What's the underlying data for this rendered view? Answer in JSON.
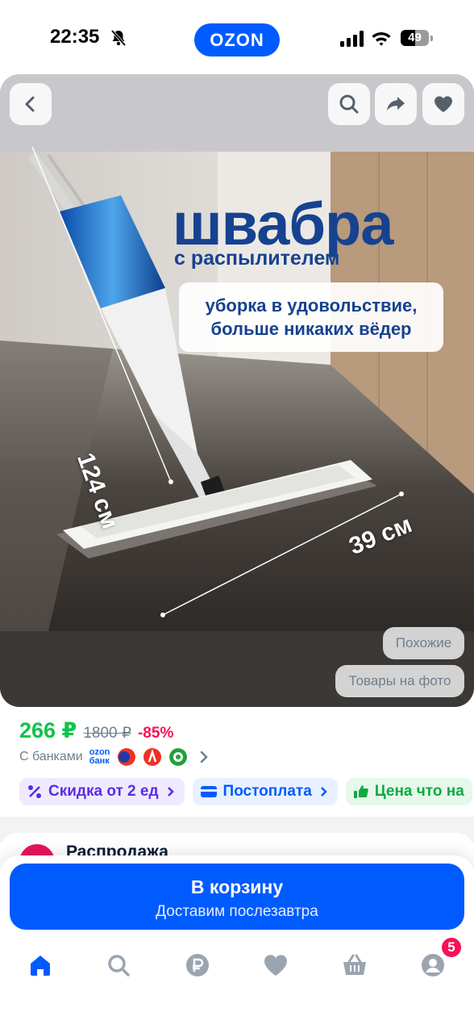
{
  "status_bar": {
    "time": "22:35",
    "app_badge": "OZON",
    "battery": "49"
  },
  "image_toolbar": {
    "back_icon": "chevron-left-icon",
    "search_icon": "search-icon",
    "share_icon": "share-icon",
    "favorite_icon": "heart-icon"
  },
  "product_image": {
    "title": "швабра",
    "subtitle": "с распылителем",
    "slogan_line1": "уборка в удовольствие,",
    "slogan_line2": "больше никаких вёдер",
    "dimension_height": "124 см",
    "dimension_width": "39 см",
    "similar_chip": "Похожие",
    "photo_items_chip": "Товары на фото"
  },
  "price": {
    "current": "266 ₽",
    "old": "1800 ₽",
    "discount": "-85%",
    "banks_label": "С банками",
    "ozon_bank_line1": "ozon",
    "ozon_bank_line2": "банк"
  },
  "tags": [
    {
      "label": "Скидка от 2 ед",
      "icon": "percent-icon"
    },
    {
      "label": "Постоплата",
      "icon": "card-icon"
    },
    {
      "label": "Цена что на",
      "icon": "thumbs-up-icon"
    }
  ],
  "seller_block": {
    "title": "Распродажа"
  },
  "cart": {
    "title": "В корзину",
    "subtitle": "Доставим послезавтра"
  },
  "bottom_nav": {
    "items": [
      "home-icon",
      "search-icon",
      "ruble-icon",
      "heart-icon",
      "basket-icon",
      "profile-icon"
    ],
    "profile_badge": "5"
  },
  "colors": {
    "brand": "#005bff",
    "price_green": "#10c44c",
    "discount_pink": "#f91155"
  }
}
